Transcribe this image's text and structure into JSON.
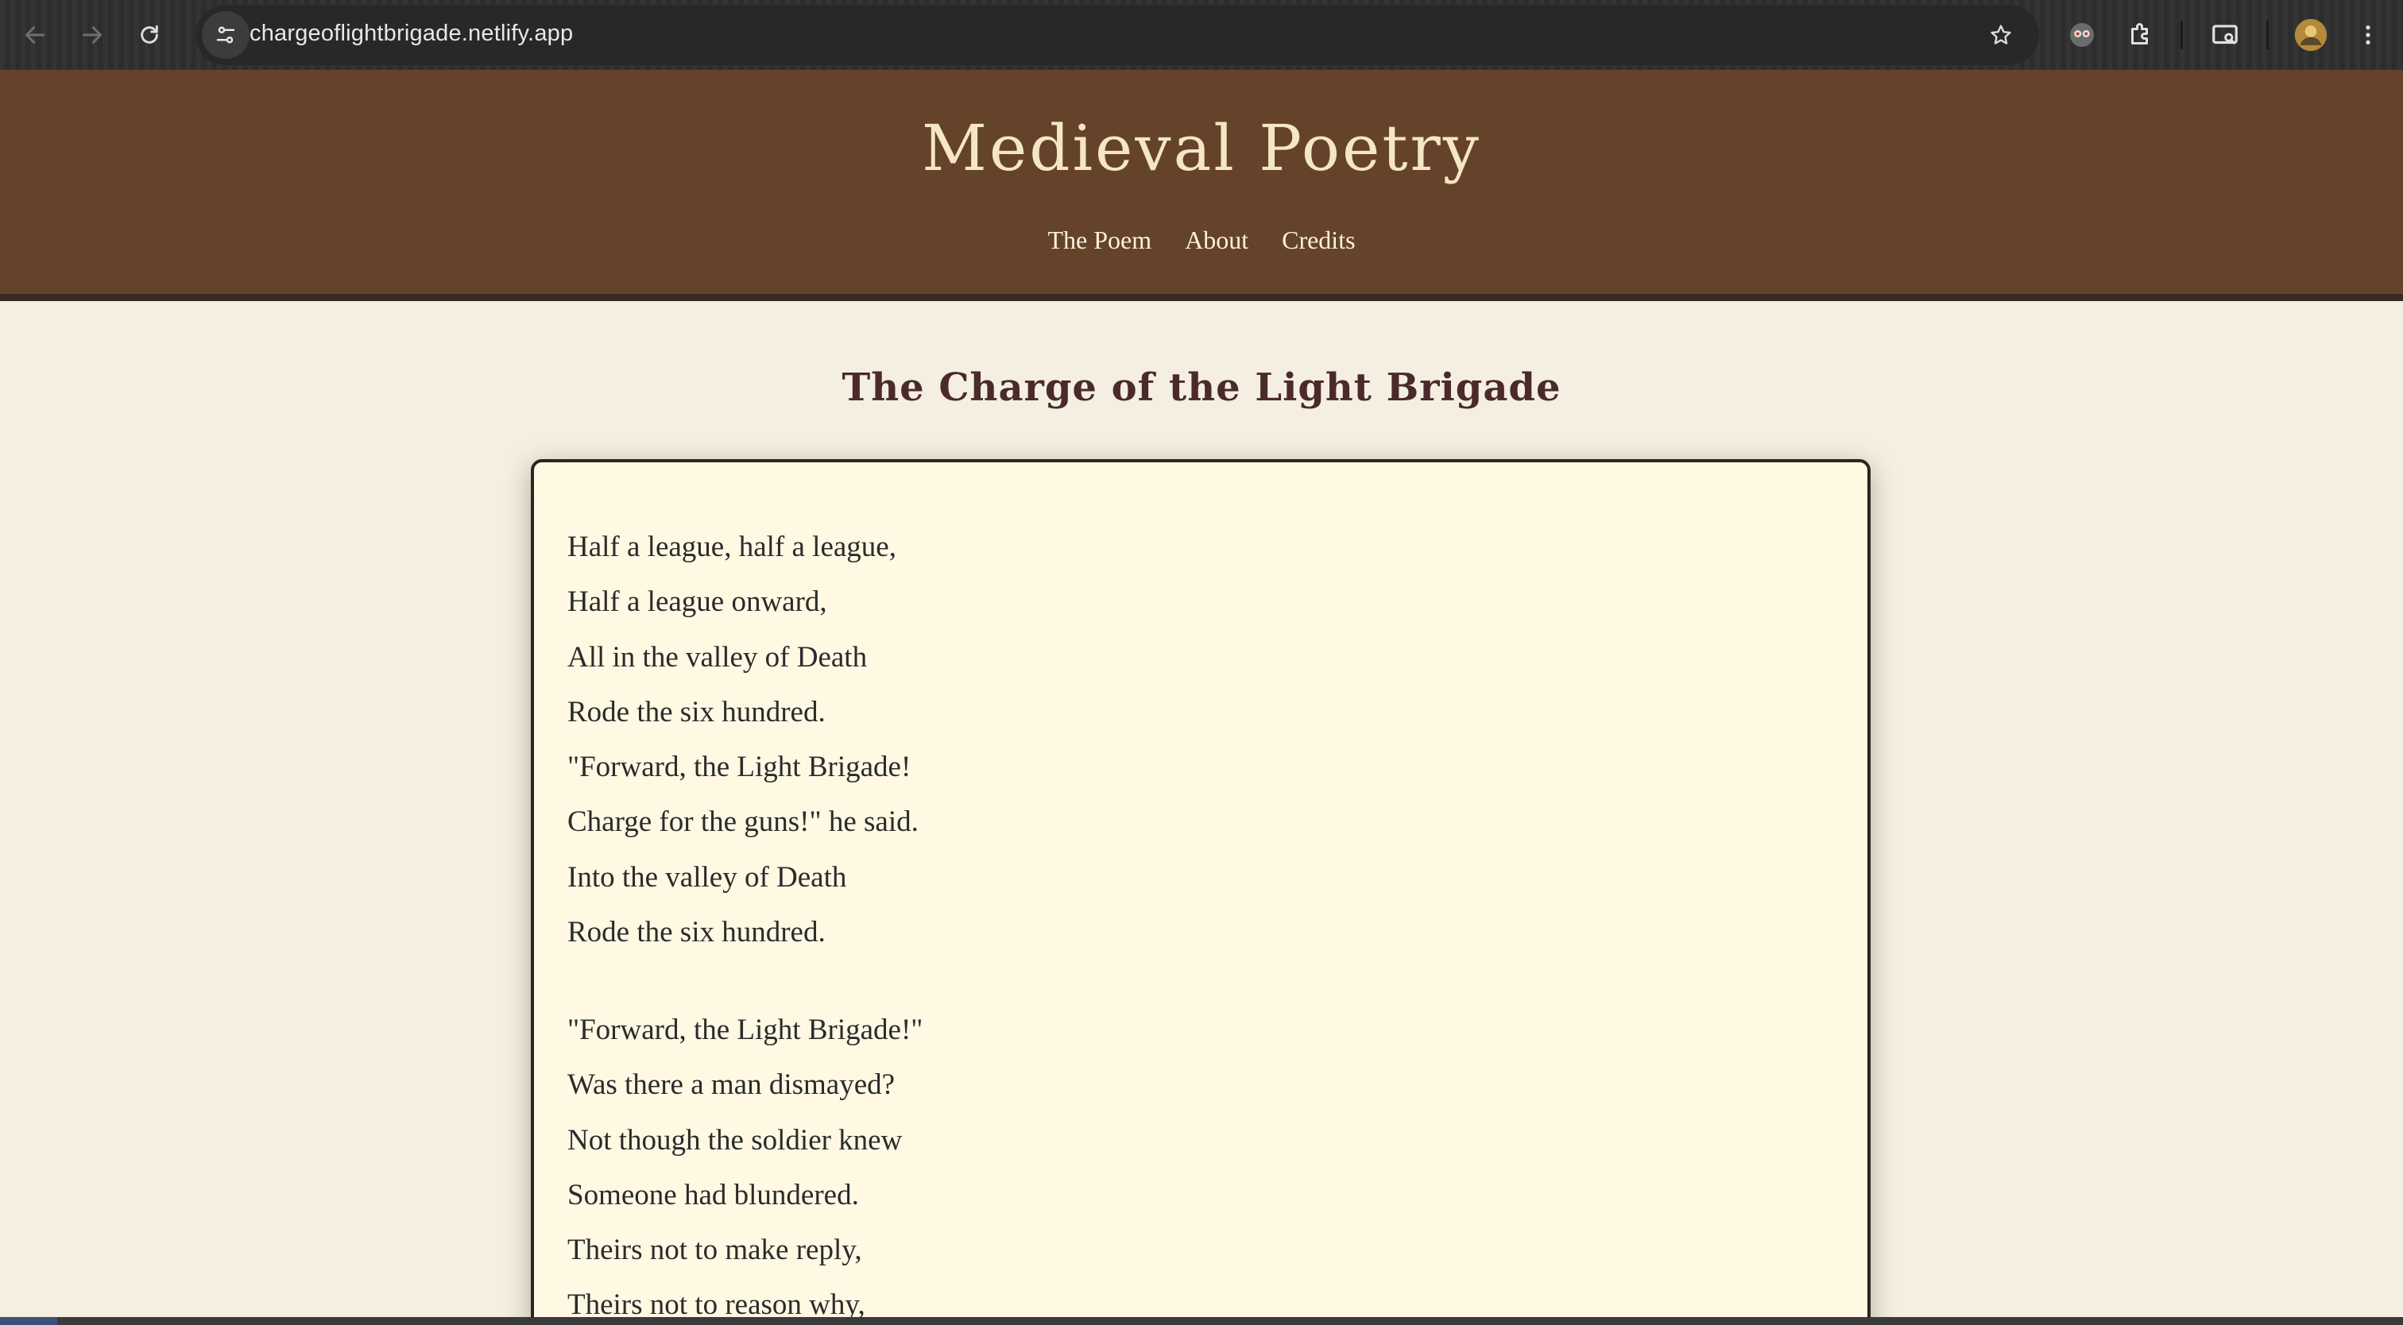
{
  "browser": {
    "url": "chargeoflightbrigade.netlify.app",
    "icons": [
      "back-arrow-icon",
      "forward-arrow-icon",
      "reload-icon",
      "site-info-icon",
      "bookmark-star-icon",
      "extension-owl-icon",
      "extensions-puzzle-icon",
      "cast-screen-icon",
      "profile-avatar-icon",
      "kebab-menu-icon"
    ]
  },
  "header": {
    "site_title": "Medieval Poetry",
    "nav": [
      "The Poem",
      "About",
      "Credits"
    ]
  },
  "poem": {
    "title": "The Charge of the Light Brigade",
    "stanzas": [
      {
        "lines": [
          "Half a league, half a league,",
          "Half a league onward,",
          "All in the valley of Death",
          "Rode the six hundred.",
          "\"Forward, the Light Brigade!",
          "Charge for the guns!\" he said.",
          "Into the valley of Death",
          "Rode the six hundred."
        ]
      },
      {
        "lines": [
          "\"Forward, the Light Brigade!\"",
          "Was there a man dismayed?",
          "Not though the soldier knew",
          "Someone had blundered.",
          "Theirs not to make reply,",
          "Theirs not to reason why,"
        ]
      }
    ]
  },
  "colors": {
    "header_bg": "#65432b",
    "header_text": "#f5e6c6",
    "page_bg": "#f4efe0",
    "card_bg": "#fff8e3",
    "title_text": "#4a2a2a"
  }
}
